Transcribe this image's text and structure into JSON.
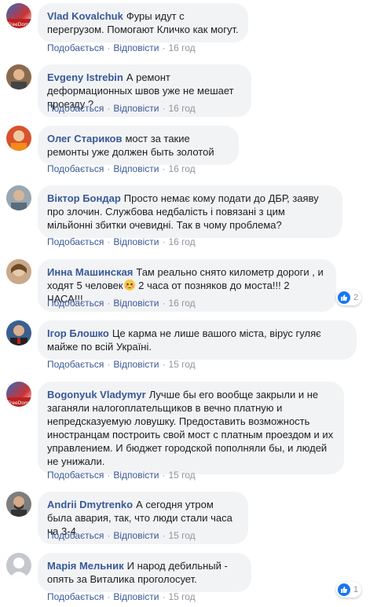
{
  "actions": {
    "like": "Подобається",
    "reply": "Відповісти",
    "dot": "·"
  },
  "comments": [
    {
      "author": "Vlad Kovalchuk",
      "text": "Фуры идут с перегрузом. Помогают Кличко как могут.",
      "time": "16 год"
    },
    {
      "author": "Evgeny Istrebin",
      "text": "А ремонт деформационных швов уже не мешает проезду ?",
      "time": "16 год"
    },
    {
      "author": "Олег Стариков",
      "text": "мост за такие ремонты уже должен быть золотой",
      "time": "16 год"
    },
    {
      "author": "Віктор Бондар",
      "text": "Просто немає кому подати до ДБР, заяву про злочин. Службова недбалість і повязані з цим мільйонні збитки очевидні. Так в чому проблема?",
      "time": "16 год"
    },
    {
      "author": "Инна Машинская",
      "text_a": "Там реально снято километр дороги , и ходят 5 человек",
      "text_b": " 2 часа от позняков до моста!!! 2 ЧАСА!!!",
      "time": "16 год",
      "reactions": "2"
    },
    {
      "author": "Ігор Блошко",
      "text": "Це карма не лише вашого міста, вірус гуляє майже по всій Україні.",
      "time": "15 год"
    },
    {
      "author": "Bogonyuk Vladymyr",
      "text": "Лучше бы его вообще закрыли и не заганяли налогоплательщиков в вечно платную и непредсказуемую ловушку. Предоставить возможность иностранцам построить свой мост с платным проездом и их управлением. И бюджет городской пополняли бы, и людей не унижали.",
      "time": "15 год"
    },
    {
      "author": "Andrii Dmytrenko",
      "text": "А сегодня утром была авария, так, что люди стали часа на 3-4",
      "time": "15 год"
    },
    {
      "author": "Марія Мельник",
      "text": "И народ дебильный - опять за Виталика проголосует.",
      "time": "15 год",
      "reactions": "1"
    }
  ],
  "colors": {
    "link": "#385898",
    "bubble": "#f2f3f5",
    "time": "#90949c",
    "like": "#1877f2"
  },
  "icons": {
    "reaction": "thumbs-up-icon",
    "emoji": "flushed-face-icon"
  }
}
